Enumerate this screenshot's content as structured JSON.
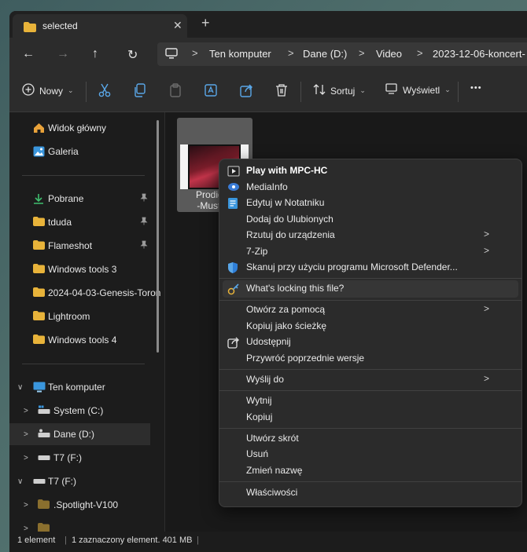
{
  "tab": {
    "title": "selected",
    "close": "✕",
    "new_tab": "+"
  },
  "nav": {
    "back": "←",
    "forward": "→",
    "up": "↑",
    "refresh": "↻"
  },
  "breadcrumb": [
    "Ten komputer",
    "Dane (D:)",
    "Video",
    "2023-12-06-koncert-"
  ],
  "breadcrumb_sep": ">",
  "toolbar": {
    "new_label": "Nowy",
    "sort_label": "Sortuj",
    "view_label": "Wyświetl",
    "more": "•••"
  },
  "sidebar": {
    "quick": [
      {
        "label": "Widok główny",
        "icon": "home-icon"
      },
      {
        "label": "Galeria",
        "icon": "gallery-icon"
      }
    ],
    "pinned": [
      {
        "label": "Pobrane",
        "icon": "download-icon",
        "pinned": true
      },
      {
        "label": "tduda",
        "icon": "folder-icon",
        "pinned": true
      },
      {
        "label": "Flameshot",
        "icon": "folder-icon",
        "pinned": true
      },
      {
        "label": "Windows tools 3",
        "icon": "folder-icon",
        "pinned": false
      },
      {
        "label": "2024-04-03-Genesis-Toron",
        "icon": "folder-icon",
        "pinned": false
      },
      {
        "label": "Lightroom",
        "icon": "folder-icon",
        "pinned": false
      },
      {
        "label": "Windows tools 4",
        "icon": "folder-icon",
        "pinned": false
      }
    ],
    "tree": [
      {
        "label": "Ten komputer",
        "icon": "computer-icon"
      },
      {
        "label": "System (C:)",
        "icon": "drive-icon"
      },
      {
        "label": "Dane (D:)",
        "icon": "drive-icon",
        "selected": true
      },
      {
        "label": "T7 (F:)",
        "icon": "usb-drive-icon"
      },
      {
        "label": "T7 (F:)",
        "icon": "usb-drive-icon"
      },
      {
        "label": ".Spotlight-V100",
        "icon": "folder-icon"
      }
    ]
  },
  "file": {
    "name_line1": "Prodigy-I",
    "name_line2": "-Must-Di"
  },
  "context_menu": {
    "items": [
      {
        "label": "Play with MPC-HC",
        "icon": "mpc-hc-icon",
        "bold": true
      },
      {
        "label": "MediaInfo",
        "icon": "mediainfo-icon"
      },
      {
        "label": "Edytuj w Notatniku",
        "icon": "notepad-icon"
      },
      {
        "label": "Dodaj do Ulubionych",
        "icon": ""
      },
      {
        "label": "Rzutuj do urządzenia",
        "icon": "",
        "submenu": true
      },
      {
        "label": "7-Zip",
        "icon": "",
        "submenu": true
      },
      {
        "label": "Skanuj przy użyciu programu Microsoft Defender...",
        "icon": "defender-icon"
      },
      {
        "label": "What's locking this file?",
        "icon": "locking-icon"
      },
      {
        "label": "Otwórz za pomocą",
        "icon": "",
        "submenu": true
      },
      {
        "label": "Kopiuj jako ścieżkę",
        "icon": ""
      },
      {
        "label": "Udostępnij",
        "icon": "share-icon"
      },
      {
        "label": "Przywróć poprzednie wersje",
        "icon": ""
      },
      {
        "label": "Wyślij do",
        "icon": "",
        "submenu": true
      },
      {
        "label": "Wytnij",
        "icon": ""
      },
      {
        "label": "Kopiuj",
        "icon": ""
      },
      {
        "label": "Utwórz skrót",
        "icon": ""
      },
      {
        "label": "Usuń",
        "icon": ""
      },
      {
        "label": "Zmień nazwę",
        "icon": ""
      },
      {
        "label": "Właściwości",
        "icon": ""
      }
    ],
    "submenu_arrow": ">"
  },
  "status": {
    "count": "1 element",
    "selected": "1 zaznaczony element. 401 MB"
  },
  "colors": {
    "folder": "#e8b33a",
    "accent": "#3a96dd",
    "selected_row": "#2d2d2d",
    "menu_bg": "#2b2b2b"
  }
}
